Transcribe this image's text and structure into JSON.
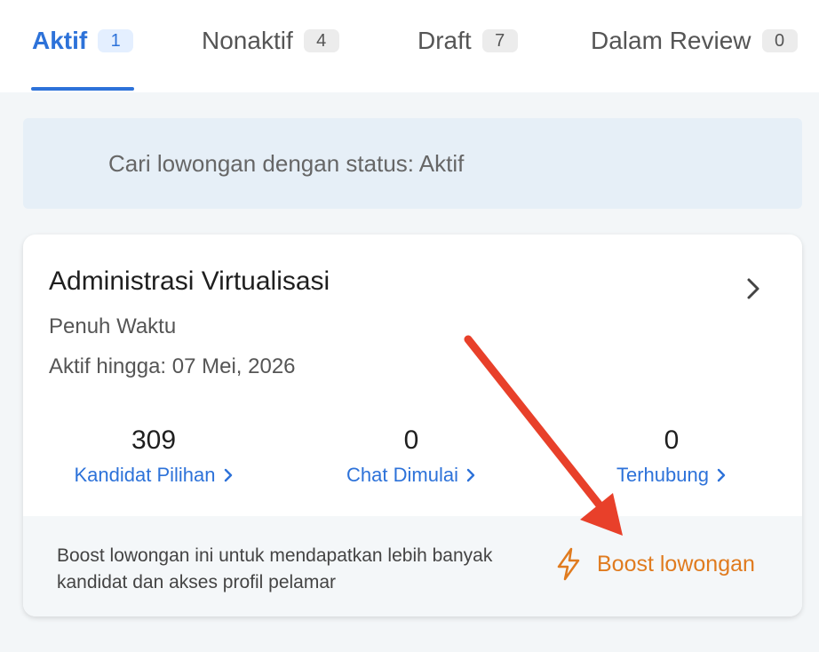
{
  "tabs": [
    {
      "label": "Aktif",
      "count": "1"
    },
    {
      "label": "Nonaktif",
      "count": "4"
    },
    {
      "label": "Draft",
      "count": "7"
    },
    {
      "label": "Dalam Review",
      "count": "0"
    }
  ],
  "search": {
    "placeholder": "Cari lowongan dengan status: Aktif",
    "icon": "search-icon"
  },
  "job": {
    "title": "Administrasi Virtualisasi",
    "type": "Penuh Waktu",
    "expiry": "Aktif hingga: 07 Mei, 2026",
    "stats": [
      {
        "value": "309",
        "label": "Kandidat Pilihan"
      },
      {
        "value": "0",
        "label": "Chat Dimulai"
      },
      {
        "value": "0",
        "label": "Terhubung"
      }
    ]
  },
  "boost": {
    "description": "Boost lowongan ini untuk mendapatkan lebih banyak kandidat dan akses profil pelamar",
    "button_label": "Boost lowongan",
    "icon": "bolt-icon"
  },
  "colors": {
    "accent": "#2d72d9",
    "boost": "#e07b1f",
    "annotation_arrow": "#e8402a"
  }
}
